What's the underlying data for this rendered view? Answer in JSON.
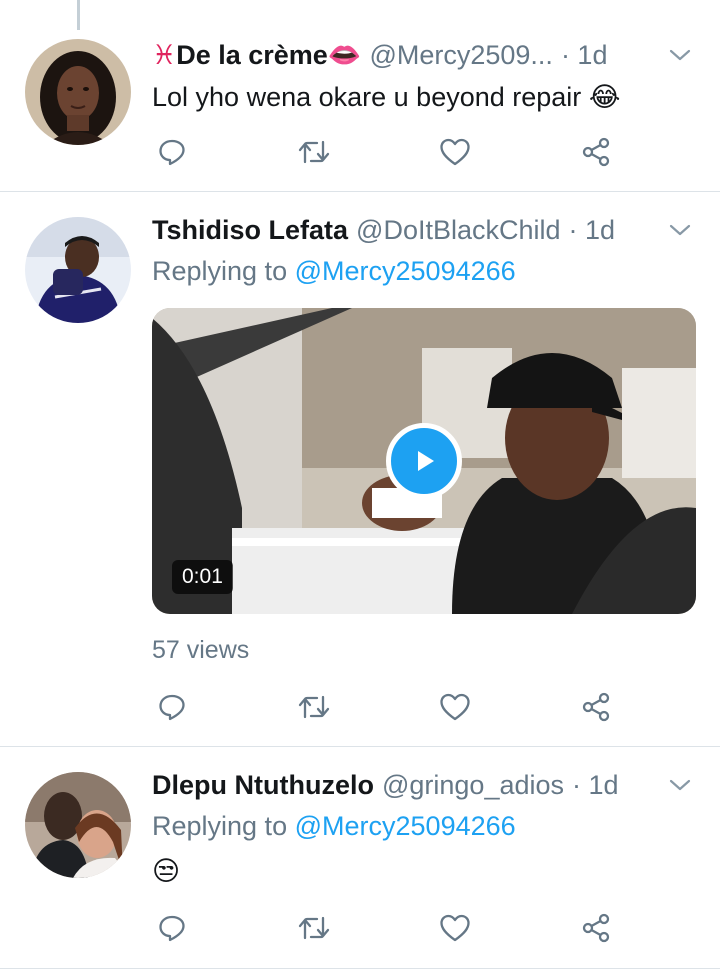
{
  "tweets": [
    {
      "name_prefix": "♓",
      "name": "De la crème",
      "name_suffix": "👄",
      "handle": "@Mercy2509...",
      "time": "· 1d",
      "text": "Lol yho wena okare u beyond repair",
      "emoji": "😂"
    },
    {
      "name": "Tshidiso Lefata",
      "handle": "@DoItBlackChild",
      "time": "· 1d",
      "replying_prefix": "Replying to",
      "replying_to": "@Mercy25094266",
      "video_duration": "0:01",
      "views": "57 views"
    },
    {
      "name": "Dlepu Ntuthuzelo",
      "handle": "@gringo_adios",
      "time": "· 1d",
      "replying_prefix": "Replying to",
      "replying_to": "@Mercy25094266",
      "emoji": "😒"
    }
  ],
  "icons": {
    "reply": "reply-icon",
    "retweet": "retweet-icon",
    "like": "heart-icon",
    "share": "share-icon",
    "menu": "chevron-down-icon",
    "play": "play-icon"
  },
  "colors": {
    "link": "#1da1f2",
    "muted": "#657786",
    "text": "#14171a"
  }
}
